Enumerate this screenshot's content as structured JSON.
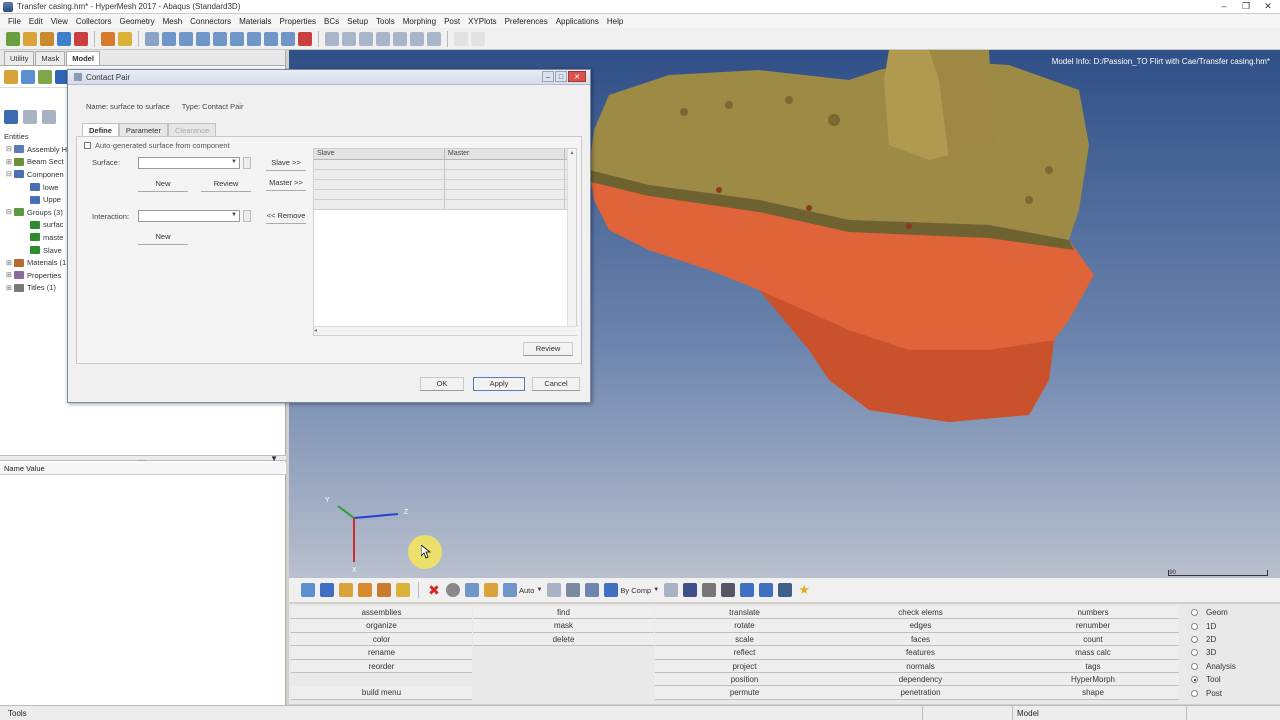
{
  "window": {
    "title": "Transfer casing.hm* - HyperMesh 2017 - Abaqus (Standard3D)",
    "controls": [
      "–",
      "❐",
      "✕"
    ]
  },
  "menubar": [
    "File",
    "Edit",
    "View",
    "Collectors",
    "Geometry",
    "Mesh",
    "Connectors",
    "Materials",
    "Properties",
    "BCs",
    "Setup",
    "Tools",
    "Morphing",
    "Post",
    "XYPlots",
    "Preferences",
    "Applications",
    "Help"
  ],
  "left_panel": {
    "tabs": [
      "Utility",
      "Mask",
      "Model"
    ],
    "active_tab": "Model",
    "section_label": "Entities",
    "tree": [
      {
        "label": "Assembly H",
        "expand": "⊟",
        "color": "#5a7bb5",
        "child": false
      },
      {
        "label": "Beam Sect",
        "expand": "⊞",
        "color": "#6b8f3a",
        "child": false
      },
      {
        "label": "Componen",
        "expand": "⊟",
        "color": "#4b6fb0",
        "child": false
      },
      {
        "label": "lowe",
        "expand": "",
        "color": "#4a6fb5",
        "child": true
      },
      {
        "label": "Uppe",
        "expand": "",
        "color": "#4a6fb5",
        "child": true
      },
      {
        "label": "Groups (3)",
        "expand": "⊟",
        "color": "#5a9a3a",
        "child": false
      },
      {
        "label": "surfac",
        "expand": "",
        "color": "#2e8b2e",
        "child": true
      },
      {
        "label": "maste",
        "expand": "",
        "color": "#2e8b2e",
        "child": true
      },
      {
        "label": "Slave",
        "expand": "",
        "color": "#2e8b2e",
        "child": true
      },
      {
        "label": "Materials (1",
        "expand": "⊞",
        "color": "#b86b30",
        "child": false
      },
      {
        "label": "Properties",
        "expand": "⊞",
        "color": "#8a6a9a",
        "child": false
      },
      {
        "label": "Titles (1)",
        "expand": "⊞",
        "color": "#777777",
        "child": false
      }
    ],
    "splitter_dots": "....",
    "name_value_header": "Name Value"
  },
  "graphics": {
    "model_info": "Model Info: D:/Passion_TO Flirt with Cae/Transfer casing.hm*",
    "scale_label": "90",
    "triad": {
      "x_label": "Y",
      "y_label": "Z",
      "z_label": "X"
    }
  },
  "dialog": {
    "title": "Contact Pair",
    "name_label": "Name: surface to surface",
    "type_label": "Type: Contact Pair",
    "tabs": [
      {
        "label": "Define",
        "state": "active"
      },
      {
        "label": "Parameter",
        "state": "normal"
      },
      {
        "label": "Clearance",
        "state": "disabled"
      }
    ],
    "auto_checkbox": "Auto-generated surface from component",
    "surface_label": "Surface:",
    "interaction_label": "Interaction:",
    "new_label": "New",
    "review_label": "Review",
    "slave_btn": "Slave >>",
    "master_btn": "Master >>",
    "remove_btn": "<< Remove",
    "list_columns": [
      "Slave",
      "Master"
    ],
    "list_review": "Review",
    "ok": "OK",
    "apply": "Apply",
    "cancel": "Cancel"
  },
  "bottom_toolbar": {
    "auto_label": "Auto",
    "bycomp_label": "By Comp"
  },
  "utility_menu": {
    "columns": [
      [
        "assemblies",
        "organize",
        "color",
        "rename",
        "reorder",
        "",
        "build menu"
      ],
      [
        "find",
        "mask",
        "delete",
        "",
        "",
        "",
        ""
      ],
      [
        "translate",
        "rotate",
        "scale",
        "reflect",
        "project",
        "position",
        "permute"
      ],
      [
        "check elems",
        "edges",
        "faces",
        "features",
        "normals",
        "dependency",
        "penetration"
      ],
      [
        "numbers",
        "renumber",
        "count",
        "mass calc",
        "tags",
        "HyperMorph",
        "shape"
      ]
    ],
    "radios": [
      {
        "label": "Geom",
        "on": false
      },
      {
        "label": "1D",
        "on": false
      },
      {
        "label": "2D",
        "on": false
      },
      {
        "label": "3D",
        "on": false
      },
      {
        "label": "Analysis",
        "on": false
      },
      {
        "label": "Tool",
        "on": true
      },
      {
        "label": "Post",
        "on": false
      }
    ]
  },
  "statusbar": {
    "left": "Tools",
    "model": "Model"
  }
}
